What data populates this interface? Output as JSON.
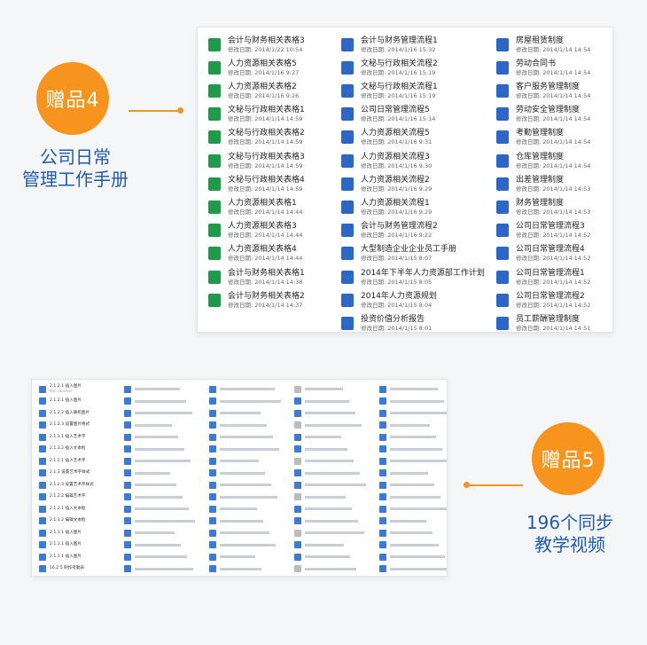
{
  "gift4": {
    "badge": "赠品4",
    "caption_lines": [
      "公司日常",
      "管理工作手册"
    ],
    "columns": [
      [
        {
          "name": "会计与财务相关表格3",
          "date": "修改日期: 2014/1/22 10:54",
          "icon": "excel-icon"
        },
        {
          "name": "人力资源相关表格5",
          "date": "修改日期: 2014/1/16 9:27",
          "icon": "excel-icon"
        },
        {
          "name": "人力资源相关表格2",
          "date": "修改日期: 2014/1/16 9:26",
          "icon": "excel-icon"
        },
        {
          "name": "文秘与行政相关表格1",
          "date": "修改日期: 2014/1/14 14:59",
          "icon": "excel-icon"
        },
        {
          "name": "文秘与行政相关表格2",
          "date": "修改日期: 2014/1/14 14:59",
          "icon": "excel-icon"
        },
        {
          "name": "文秘与行政相关表格3",
          "date": "修改日期: 2014/1/14 14:59",
          "icon": "excel-icon"
        },
        {
          "name": "文秘与行政相关表格4",
          "date": "修改日期: 2014/1/14 14:59",
          "icon": "excel-icon"
        },
        {
          "name": "人力资源相关表格1",
          "date": "修改日期: 2014/1/14 14:44",
          "icon": "excel-icon"
        },
        {
          "name": "人力资源相关表格3",
          "date": "修改日期: 2014/1/14 14:44",
          "icon": "excel-icon"
        },
        {
          "name": "人力资源相关表格4",
          "date": "修改日期: 2014/1/14 14:44",
          "icon": "excel-icon"
        },
        {
          "name": "会计与财务相关表格1",
          "date": "修改日期: 2014/1/14 14:38",
          "icon": "excel-icon"
        },
        {
          "name": "会计与财务相关表格2",
          "date": "修改日期: 2014/1/14 14:37",
          "icon": "excel-icon"
        }
      ],
      [
        {
          "name": "会计与财务管理流程1",
          "date": "修改日期: 2014/1/16 15:32",
          "icon": "word-icon"
        },
        {
          "name": "文秘与行政相关流程2",
          "date": "修改日期: 2014/1/16 15:19",
          "icon": "word-icon"
        },
        {
          "name": "文秘与行政相关流程1",
          "date": "修改日期: 2014/1/16 15:19",
          "icon": "word-icon"
        },
        {
          "name": "公司日常管理流程5",
          "date": "修改日期: 2014/1/16 15:14",
          "icon": "word-icon"
        },
        {
          "name": "人力资源相关流程5",
          "date": "修改日期: 2014/1/16 9:31",
          "icon": "word-icon"
        },
        {
          "name": "人力资源相关流程3",
          "date": "修改日期: 2014/1/16 9:30",
          "icon": "word-icon"
        },
        {
          "name": "人力资源相关流程2",
          "date": "修改日期: 2014/1/16 9:29",
          "icon": "word-icon"
        },
        {
          "name": "人力资源相关流程1",
          "date": "修改日期: 2014/1/16 9:29",
          "icon": "word-icon"
        },
        {
          "name": "会计与财务管理流程2",
          "date": "修改日期: 2014/1/16 9:22",
          "icon": "word-icon"
        },
        {
          "name": "大型制造企业企业员工手册",
          "date": "修改日期: 2014/1/15 8:07",
          "icon": "word-icon"
        },
        {
          "name": "2014年下半年人力资源部工作计划",
          "date": "修改日期: 2014/1/15 8:05",
          "icon": "word-icon"
        },
        {
          "name": "2014年人力资源规划",
          "date": "修改日期: 2014/1/15 8:04",
          "icon": "word-icon"
        },
        {
          "name": "投资价值分析报告",
          "date": "修改日期: 2014/1/15 8:01",
          "icon": "word-icon"
        }
      ],
      [
        {
          "name": "房屋租赁制度",
          "date": "修改日期: 2014/1/14 14:54",
          "icon": "word-icon"
        },
        {
          "name": "劳动合同书",
          "date": "修改日期: 2014/1/14 14:54",
          "icon": "word-icon"
        },
        {
          "name": "客户服务管理制度",
          "date": "修改日期: 2014/1/14 14:54",
          "icon": "word-icon"
        },
        {
          "name": "劳动安全管理制度",
          "date": "修改日期: 2014/1/14 14:54",
          "icon": "word-icon"
        },
        {
          "name": "考勤管理制度",
          "date": "修改日期: 2014/1/14 14:54",
          "icon": "word-icon"
        },
        {
          "name": "仓库管理制度",
          "date": "修改日期: 2014/1/14 14:54",
          "icon": "word-icon"
        },
        {
          "name": "出差管理制度",
          "date": "修改日期: 2014/1/14 14:53",
          "icon": "word-icon"
        },
        {
          "name": "财务管理制度",
          "date": "修改日期: 2014/1/14 14:53",
          "icon": "word-icon"
        },
        {
          "name": "公司日常管理流程3",
          "date": "修改日期: 2014/1/14 14:52",
          "icon": "word-icon"
        },
        {
          "name": "公司日常管理流程4",
          "date": "修改日期: 2014/1/14 14:52",
          "icon": "word-icon"
        },
        {
          "name": "公司日常管理流程1",
          "date": "修改日期: 2014/1/14 14:52",
          "icon": "word-icon"
        },
        {
          "name": "公司日常管理流程2",
          "date": "修改日期: 2014/1/14 14:52",
          "icon": "word-icon"
        },
        {
          "name": "员工薪酬管理制度",
          "date": "修改日期: 2014/1/14 14:51",
          "icon": "word-icon"
        }
      ]
    ]
  },
  "gift5": {
    "badge": "赠品5",
    "caption_lines": [
      "196个同步",
      "教学视频"
    ],
    "columns": [
      [
        {
          "name": "2.1.2.1 插入图片",
          "date": "时长: 00:00:47"
        },
        {
          "name": "2.1.2.1 插入图片"
        },
        {
          "name": "2.1.2.2 插入联机图片"
        },
        {
          "name": "2.1.2.3 设置图片格式"
        },
        {
          "name": "2.1.3.1 插入艺术字"
        },
        {
          "name": "2.1.3.2 插入文本框"
        },
        {
          "name": "2.1.2.1 插入艺术字"
        },
        {
          "name": "2.1.3 设置艺术字样式"
        },
        {
          "name": "2.1.2.3 设置艺术字样式"
        },
        {
          "name": "2.1.2.2 编辑艺术字"
        },
        {
          "name": "2.1.2.1 插入文本框"
        },
        {
          "name": "2.1.1.2 编辑文本框"
        },
        {
          "name": "2.1.1.1 插入图片"
        },
        {
          "name": "2.1.1.1 插入图片"
        },
        {
          "name": "2.1.1.1 插入图片"
        },
        {
          "name": "16.2.5 制作考勤表"
        }
      ]
    ]
  }
}
